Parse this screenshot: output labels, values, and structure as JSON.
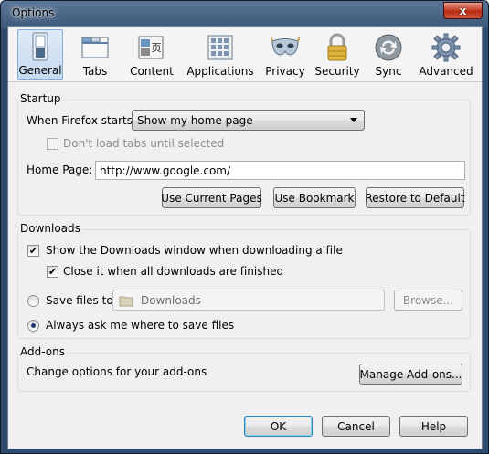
{
  "window": {
    "title": "Options",
    "close_glyph": "x"
  },
  "toolbar": {
    "panes": [
      {
        "label": "General",
        "icon": "switch-icon",
        "selected": true
      },
      {
        "label": "Tabs",
        "icon": "tabs-icon",
        "selected": false
      },
      {
        "label": "Content",
        "icon": "content-icon",
        "selected": false
      },
      {
        "label": "Applications",
        "icon": "applications-icon",
        "selected": false
      },
      {
        "label": "Privacy",
        "icon": "mask-icon",
        "selected": false
      },
      {
        "label": "Security",
        "icon": "padlock-icon",
        "selected": false
      },
      {
        "label": "Sync",
        "icon": "sync-icon",
        "selected": false
      },
      {
        "label": "Advanced",
        "icon": "gear-icon",
        "selected": false
      }
    ]
  },
  "startup": {
    "caption": "Startup",
    "when_starts_label": "When Firefox starts:",
    "when_starts_value": "Show my home page",
    "dont_load_tabs_label": "Don't load tabs until selected",
    "dont_load_tabs_checked": false,
    "home_page_label": "Home Page:",
    "home_page_value": "http://www.google.com/",
    "use_current_pages": "Use Current Pages",
    "use_bookmark": "Use Bookmark",
    "restore_default": "Restore to Default"
  },
  "downloads": {
    "caption": "Downloads",
    "show_window_label": "Show the Downloads window when downloading a file",
    "show_window_checked": true,
    "close_it_label": "Close it when all downloads are finished",
    "close_it_checked": true,
    "save_files_label": "Save files to",
    "save_folder": "Downloads",
    "browse": "Browse...",
    "always_ask_label": "Always ask me where to save files",
    "always_ask_selected": true
  },
  "addons": {
    "caption": "Add-ons",
    "description": "Change options for your add-ons",
    "manage": "Manage Add-ons..."
  },
  "footer": {
    "ok": "OK",
    "cancel": "Cancel",
    "help": "Help"
  },
  "colors": {
    "selected_tab": "#c4d9ef",
    "title_bar": "#3a5779",
    "close_button": "#c8452d"
  }
}
